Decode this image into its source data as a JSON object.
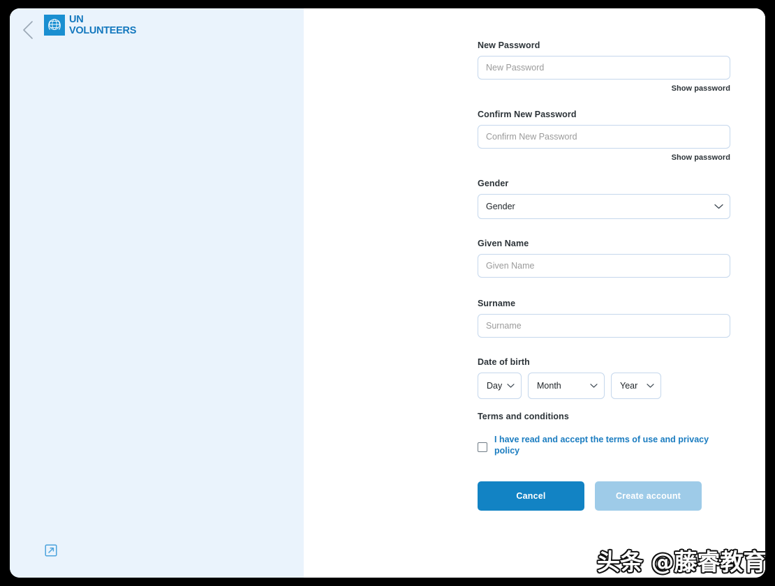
{
  "window": {
    "background_color": "#000000",
    "card_color": "#ffffff"
  },
  "sidebar": {
    "background_color": "#eaf3fc",
    "back_icon": "chevron-left-icon",
    "brand": {
      "emblem": "un-emblem-icon",
      "line1": "UN",
      "line2": "VOLUNTEERS",
      "color": "#1478be"
    },
    "external_link_icon": "external-link-icon",
    "external_link_color": "#4ba3dd"
  },
  "form": {
    "new_password": {
      "label": "New Password",
      "placeholder": "New Password",
      "value": "",
      "show_password_label": "Show password"
    },
    "confirm_password": {
      "label": "Confirm New Password",
      "placeholder": "Confirm New Password",
      "value": "",
      "show_password_label": "Show password"
    },
    "gender": {
      "label": "Gender",
      "selected": "Gender",
      "chevron": "chevron-down-icon"
    },
    "given_name": {
      "label": "Given Name",
      "placeholder": "Given Name",
      "value": ""
    },
    "surname": {
      "label": "Surname",
      "placeholder": "Surname",
      "value": ""
    },
    "date_of_birth": {
      "label": "Date of birth",
      "day": "Day",
      "month": "Month",
      "year": "Year"
    },
    "terms": {
      "label": "Terms and conditions",
      "checkbox_checked": false,
      "link_text": "I have read and accept the terms of use and privacy policy",
      "link_color": "#1a7cc0"
    },
    "buttons": {
      "cancel": "Cancel",
      "cancel_color": "#1283c4",
      "submit": "Create account",
      "submit_color": "#9ecbe8"
    }
  },
  "watermark": {
    "text": "头条 @藤睿教育"
  }
}
